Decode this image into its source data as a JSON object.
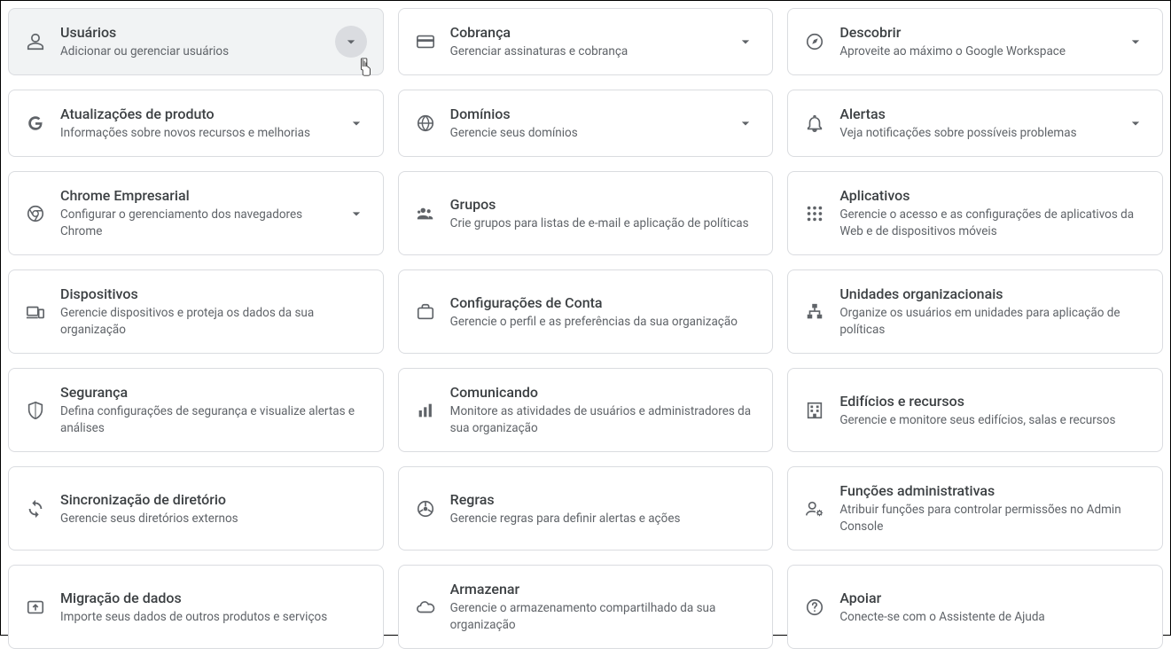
{
  "cards": [
    {
      "title": "Usuários",
      "desc": "Adicionar ou gerenciar usuários",
      "icon": "person",
      "expand": true,
      "active": true
    },
    {
      "title": "Cobrança",
      "desc": "Gerenciar assinaturas e cobrança",
      "icon": "credit-card",
      "expand": true
    },
    {
      "title": "Descobrir",
      "desc": "Aproveite ao máximo o Google Workspace",
      "icon": "compass",
      "expand": true
    },
    {
      "title": "Atualizações de produto",
      "desc": "Informações sobre novos recursos e melhorias",
      "icon": "google-g",
      "expand": true
    },
    {
      "title": "Domínios",
      "desc": "Gerencie seus domínios",
      "icon": "globe",
      "expand": true
    },
    {
      "title": "Alertas",
      "desc": "Veja notificações sobre possíveis problemas",
      "icon": "bell",
      "expand": true
    },
    {
      "title": "Chrome Empresarial",
      "desc": "Configurar o gerenciamento dos navegadores Chrome",
      "icon": "chrome",
      "expand": true
    },
    {
      "title": "Grupos",
      "desc": "Crie grupos para listas de e-mail e aplicação de políticas",
      "icon": "groups"
    },
    {
      "title": "Aplicativos",
      "desc": "Gerencie o acesso e as configurações de aplicativos da Web e de dispositivos móveis",
      "icon": "apps"
    },
    {
      "title": "Dispositivos",
      "desc": "Gerencie dispositivos e proteja os dados da sua organização",
      "icon": "devices"
    },
    {
      "title": "Configurações de Conta",
      "desc": "Gerencie o perfil e as preferências da sua organização",
      "icon": "briefcase"
    },
    {
      "title": "Unidades organizacionais",
      "desc": "Organize os usuários em unidades para aplicação de políticas",
      "icon": "org-tree"
    },
    {
      "title": "Segurança",
      "desc": "Defina configurações de segurança e visualize alertas e análises",
      "icon": "shield"
    },
    {
      "title": "Comunicando",
      "desc": "Monitore as atividades de usuários e administradores da sua organização",
      "icon": "bar-chart"
    },
    {
      "title": "Edifícios e recursos",
      "desc": "Gerencie e monitore seus edifícios, salas e recursos",
      "icon": "building"
    },
    {
      "title": "Sincronização de diretório",
      "desc": "Gerencie seus diretórios externos",
      "icon": "sync"
    },
    {
      "title": "Regras",
      "desc": "Gerencie regras para definir alertas e ações",
      "icon": "steering"
    },
    {
      "title": "Funções administrativas",
      "desc": "Atribuir funções para controlar permissões no Admin Console",
      "icon": "admin-role"
    },
    {
      "title": "Migração de dados",
      "desc": "Importe seus dados de outros produtos e serviços",
      "icon": "upload-box"
    },
    {
      "title": "Armazenar",
      "desc": "Gerencie o armazenamento compartilhado da sua organização",
      "icon": "cloud"
    },
    {
      "title": "Apoiar",
      "desc": "Conecte-se com o Assistente de Ajuda",
      "icon": "help"
    }
  ]
}
